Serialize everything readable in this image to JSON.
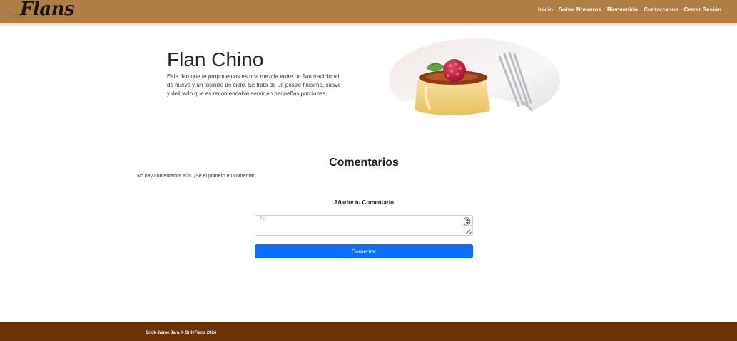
{
  "colors": {
    "navbar": "#b07e44",
    "footer": "#6b3305",
    "button": "#0d6efd"
  },
  "header": {
    "brand_small": "Only",
    "brand_big": "Flans",
    "nav": [
      {
        "label": "Inicio"
      },
      {
        "label": "Sobre Nosotros"
      },
      {
        "label": "Bienvenido"
      },
      {
        "label": "Contactanos"
      },
      {
        "label": "Cerrar Sesión"
      }
    ]
  },
  "hero": {
    "title": "Flan Chino",
    "description": "Este flan que te proponemos es una mezcla entre un flan tradicional de huevo y un tocinillo de cielo. Se trata de un postre finísimo, suave y delicado que es recomendable servir en pequeñas porciones."
  },
  "comments": {
    "title": "Comentarios",
    "empty_message": "No hay comentarios aún. ¡Sé el primero en comentar!",
    "add_title": "Añadre tu Comentario",
    "input_placeholder": "Txt",
    "input_value": "",
    "submit_label": "Comentar"
  },
  "footer": {
    "text": "Erick Jaime Jara © OnlyFlans 2024"
  }
}
